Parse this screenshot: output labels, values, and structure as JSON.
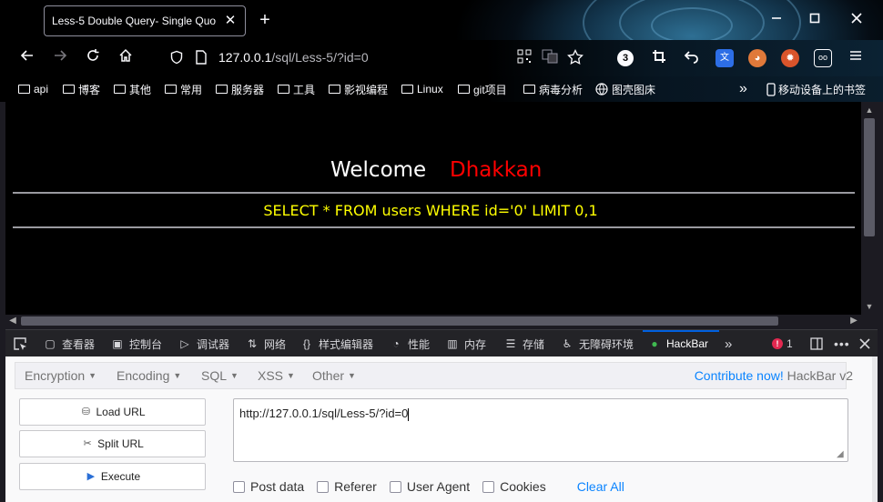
{
  "browser": {
    "tab_title": "Less-5 Double Query- Single Quo",
    "tab_close": "✕",
    "new_tab": "+",
    "url_host": "127.0.0.1",
    "url_path": "/sql/Less-5/?id=0",
    "ext_badge": "3",
    "accent": "#0060df"
  },
  "bookmarks": [
    {
      "label": "api"
    },
    {
      "label": "博客"
    },
    {
      "label": "其他"
    },
    {
      "label": "常用"
    },
    {
      "label": "服务器"
    },
    {
      "label": "工具"
    },
    {
      "label": "影视编程"
    },
    {
      "label": "Linux"
    },
    {
      "label": "git项目"
    },
    {
      "label": "病毒分析"
    },
    {
      "label": "图壳图床"
    }
  ],
  "bookmarks_overflow": "»",
  "mobile_bookmarks": "移动设备上的书签",
  "page": {
    "welcome": "Welcome",
    "name": "Dhakkan",
    "query": "SELECT * FROM users WHERE id='0' LIMIT 0,1"
  },
  "devtools": {
    "tabs": [
      {
        "label": "查看器",
        "icon": "inspector-icon"
      },
      {
        "label": "控制台",
        "icon": "console-icon"
      },
      {
        "label": "调试器",
        "icon": "debugger-icon"
      },
      {
        "label": "网络",
        "icon": "network-icon"
      },
      {
        "label": "样式编辑器",
        "icon": "style-editor-icon"
      },
      {
        "label": "性能",
        "icon": "performance-icon"
      },
      {
        "label": "内存",
        "icon": "memory-icon"
      },
      {
        "label": "存储",
        "icon": "storage-icon"
      },
      {
        "label": "无障碍环境",
        "icon": "accessibility-icon"
      },
      {
        "label": "HackBar",
        "icon": "hackbar-icon"
      }
    ],
    "more": "»",
    "error_count": "1",
    "error_badge": "!"
  },
  "hackbar": {
    "menu": [
      {
        "label": "Encryption"
      },
      {
        "label": "Encoding"
      },
      {
        "label": "SQL"
      },
      {
        "label": "XSS"
      },
      {
        "label": "Other"
      }
    ],
    "contribute": "Contribute now!",
    "version": "HackBar v2",
    "buttons": {
      "load": "Load URL",
      "split": "Split URL",
      "execute": "Execute"
    },
    "url_value": "http://127.0.0.1/sql/Less-5/?id=0",
    "options": {
      "post": "Post data",
      "referer": "Referer",
      "user_agent": "User Agent",
      "cookies": "Cookies"
    },
    "clear_all": "Clear All"
  }
}
